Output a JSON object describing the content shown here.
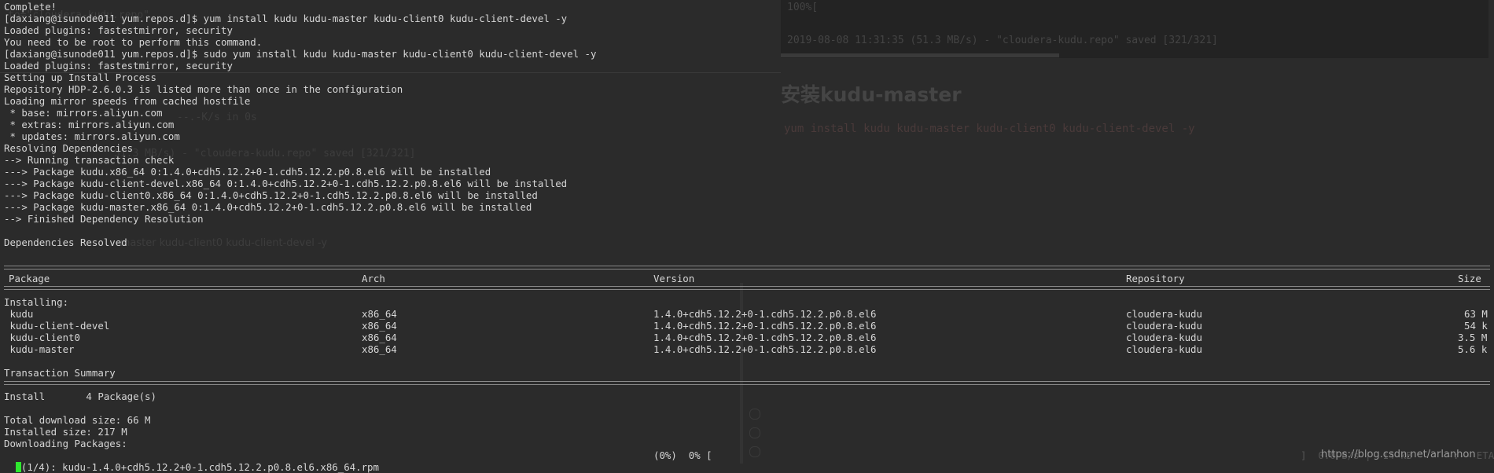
{
  "ghost": {
    "top_left": "to=\"cloudera-kudu.repo\"",
    "code_line1": "100%[",
    "code_line2": "2019-08-08 11:31:35 (51.3 MB/s) - \"cloudera-kudu.repo\" saved [321/321]",
    "heading": "安装kudu-master",
    "command": "yum install kudu kudu-master kudu-client0 kudu-client-devel -y",
    "mid_line1": "--.-K/s    in 0s",
    "mid_line2": "51.3 MB/s) - \"cloudera-kudu.repo\" saved [321/321]",
    "mid_line3": "-master kudu-client0 kudu-client-devel -y"
  },
  "terminal": {
    "lines": [
      "Complete!",
      "[daxiang@isunode011 yum.repos.d]$ yum install kudu kudu-master kudu-client0 kudu-client-devel -y",
      "Loaded plugins: fastestmirror, security",
      "You need to be root to perform this command.",
      "[daxiang@isunode011 yum.repos.d]$ sudo yum install kudu kudu-master kudu-client0 kudu-client-devel -y",
      "Loaded plugins: fastestmirror, security",
      "Setting up Install Process",
      "Repository HDP-2.6.0.3 is listed more than once in the configuration",
      "Loading mirror speeds from cached hostfile",
      " * base: mirrors.aliyun.com",
      " * extras: mirrors.aliyun.com",
      " * updates: mirrors.aliyun.com",
      "Resolving Dependencies",
      "--> Running transaction check",
      "---> Package kudu.x86_64 0:1.4.0+cdh5.12.2+0-1.cdh5.12.2.p0.8.el6 will be installed",
      "---> Package kudu-client-devel.x86_64 0:1.4.0+cdh5.12.2+0-1.cdh5.12.2.p0.8.el6 will be installed",
      "---> Package kudu-client0.x86_64 0:1.4.0+cdh5.12.2+0-1.cdh5.12.2.p0.8.el6 will be installed",
      "---> Package kudu-master.x86_64 0:1.4.0+cdh5.12.2+0-1.cdh5.12.2.p0.8.el6 will be installed",
      "--> Finished Dependency Resolution",
      "",
      "Dependencies Resolved"
    ],
    "table": {
      "headers": {
        "package": "Package",
        "arch": "Arch",
        "version": "Version",
        "repository": "Repository",
        "size": "Size"
      },
      "section": "Installing:",
      "rows": [
        {
          "package": " kudu",
          "arch": "x86_64",
          "version": "1.4.0+cdh5.12.2+0-1.cdh5.12.2.p0.8.el6",
          "repository": "cloudera-kudu",
          "size": "63 M"
        },
        {
          "package": " kudu-client-devel",
          "arch": "x86_64",
          "version": "1.4.0+cdh5.12.2+0-1.cdh5.12.2.p0.8.el6",
          "repository": "cloudera-kudu",
          "size": "54 k"
        },
        {
          "package": " kudu-client0",
          "arch": "x86_64",
          "version": "1.4.0+cdh5.12.2+0-1.cdh5.12.2.p0.8.el6",
          "repository": "cloudera-kudu",
          "size": "3.5 M"
        },
        {
          "package": " kudu-master",
          "arch": "x86_64",
          "version": "1.4.0+cdh5.12.2+0-1.cdh5.12.2.p0.8.el6",
          "repository": "cloudera-kudu",
          "size": "5.6 k"
        }
      ]
    },
    "summary_title": "Transaction Summary",
    "install_line": "Install       4 Package(s)",
    "total_download": "Total download size: 66 M",
    "installed_size": "Installed size: 217 M",
    "downloading": "Downloading Packages:",
    "progress": {
      "prefix": "(1/4): kudu-1.4.0+cdh5.12.2+0-1.cdh5.12.2.p0.8.el6.x86_64.rpm",
      "percent": "(0%)  0% [",
      "tail": "]  0.0 B/s |  14 kB     --:-- ETA"
    },
    "cursor_color": "#2ee82e"
  },
  "watermark": "https://blog.csdn.net/arlanhon"
}
